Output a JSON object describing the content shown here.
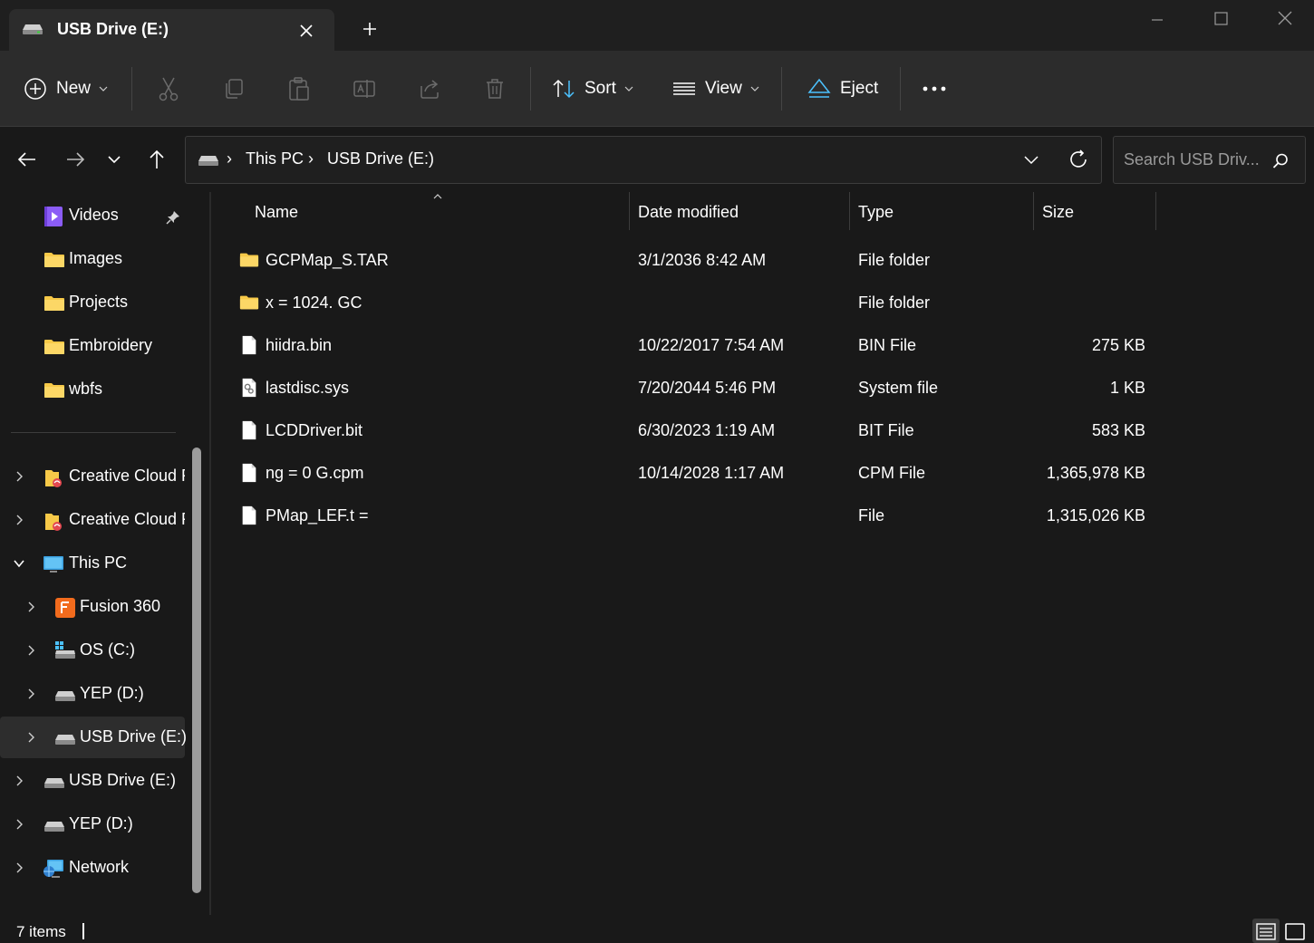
{
  "window": {
    "tab_title": "USB Drive (E:)",
    "tab_icon": "usb-drive-icon"
  },
  "toolbar": {
    "new_label": "New",
    "sort_label": "Sort",
    "view_label": "View",
    "eject_label": "Eject"
  },
  "address": {
    "crumbs": [
      "This PC",
      "USB Drive (E:)"
    ],
    "search_placeholder": "Search USB Driv..."
  },
  "sidebar": {
    "quick_access": [
      {
        "label": "Videos",
        "icon": "videos-folder-icon",
        "pinned": true
      },
      {
        "label": "Images",
        "icon": "folder-icon"
      },
      {
        "label": "Projects",
        "icon": "folder-icon"
      },
      {
        "label": "Embroidery",
        "icon": "folder-icon"
      },
      {
        "label": "wbfs",
        "icon": "folder-icon"
      }
    ],
    "tree": [
      {
        "label": "Creative Cloud F",
        "icon": "creative-cloud-icon",
        "expanded": false
      },
      {
        "label": "Creative Cloud F",
        "icon": "creative-cloud-icon",
        "expanded": false
      },
      {
        "label": "This PC",
        "icon": "this-pc-icon",
        "expanded": true
      },
      {
        "label": "Fusion 360",
        "icon": "fusion-360-icon",
        "expanded": false
      },
      {
        "label": "OS (C:)",
        "icon": "os-drive-icon",
        "expanded": false
      },
      {
        "label": "YEP (D:)",
        "icon": "drive-icon",
        "expanded": false
      },
      {
        "label": "USB Drive (E:)",
        "icon": "drive-icon",
        "expanded": false,
        "selected": true
      },
      {
        "label": "USB Drive (E:)",
        "icon": "drive-icon",
        "expanded": false
      },
      {
        "label": "YEP (D:)",
        "icon": "drive-icon",
        "expanded": false
      },
      {
        "label": "Network",
        "icon": "network-icon",
        "expanded": false
      }
    ]
  },
  "file_list": {
    "columns": [
      "Name",
      "Date modified",
      "Type",
      "Size"
    ],
    "rows": [
      {
        "name": "GCPMap_S.TAR",
        "date": "3/1/2036 8:42 AM",
        "type": "File folder",
        "size": "",
        "icon": "folder-icon"
      },
      {
        "name": "x = 1024. GC",
        "date": "",
        "type": "File folder",
        "size": "",
        "icon": "folder-icon"
      },
      {
        "name": "hiidra.bin",
        "date": "10/22/2017 7:54 AM",
        "type": "BIN File",
        "size": "275 KB",
        "icon": "file-icon"
      },
      {
        "name": "lastdisc.sys",
        "date": "7/20/2044 5:46 PM",
        "type": "System file",
        "size": "1 KB",
        "icon": "system-file-icon"
      },
      {
        "name": "LCDDriver.bit",
        "date": "6/30/2023 1:19 AM",
        "type": "BIT File",
        "size": "583 KB",
        "icon": "file-icon"
      },
      {
        "name": "ng = 0 G.cpm",
        "date": "10/14/2028 1:17 AM",
        "type": "CPM File",
        "size": "1,365,978 KB",
        "icon": "file-icon"
      },
      {
        "name": "PMap_LEF.t =",
        "date": "",
        "type": "File",
        "size": "1,315,026 KB",
        "icon": "file-icon"
      }
    ]
  },
  "status": {
    "item_count": "7 items"
  },
  "colors": {
    "background": "#191919",
    "toolbar": "#2c2c2c",
    "folder": "#f7c948",
    "accent": "#4cc2ff"
  }
}
